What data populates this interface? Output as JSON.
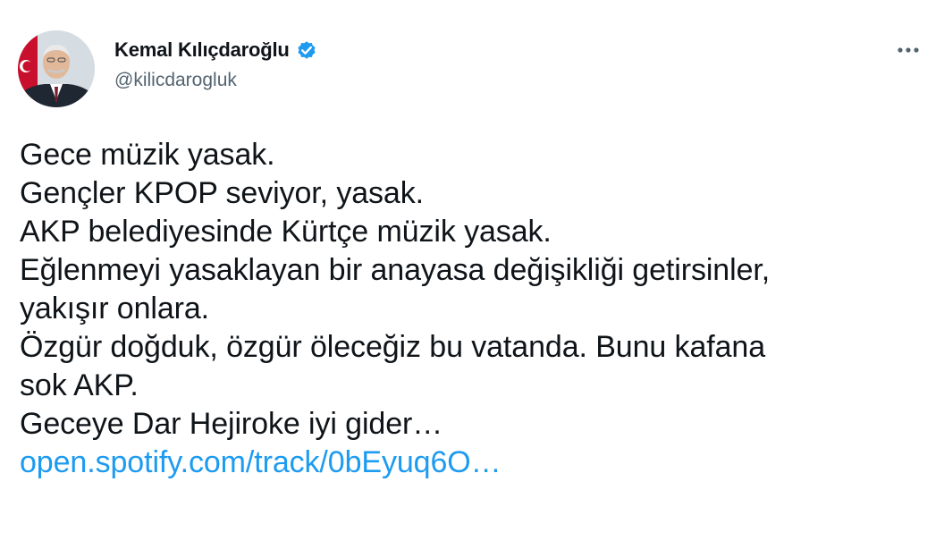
{
  "author": {
    "display_name": "Kemal Kılıçdaroğlu",
    "handle": "@kilicdarogluk",
    "verified": true,
    "avatar_icon": "profile-photo",
    "verified_icon": "verified-badge-icon"
  },
  "menu": {
    "more_icon": "more-horizontal-icon"
  },
  "tweet": {
    "lines": [
      "Gece müzik yasak.",
      "Gençler KPOP seviyor, yasak.",
      "AKP belediyesinde Kürtçe müzik yasak.",
      "Eğlenmeyi yasaklayan bir anayasa değişikliği getirsinler,",
      "yakışır onlara.",
      "Özgür doğduk, özgür öleceğiz bu vatanda. Bunu kafana",
      "sok AKP.",
      "Geceye Dar Hejiroke iyi gider…"
    ],
    "link_text": "open.spotify.com/track/0bEyuq6O…"
  },
  "colors": {
    "text": "#0f1419",
    "secondary": "#536471",
    "link": "#1d9bf0",
    "verified": "#1d9bf0"
  }
}
